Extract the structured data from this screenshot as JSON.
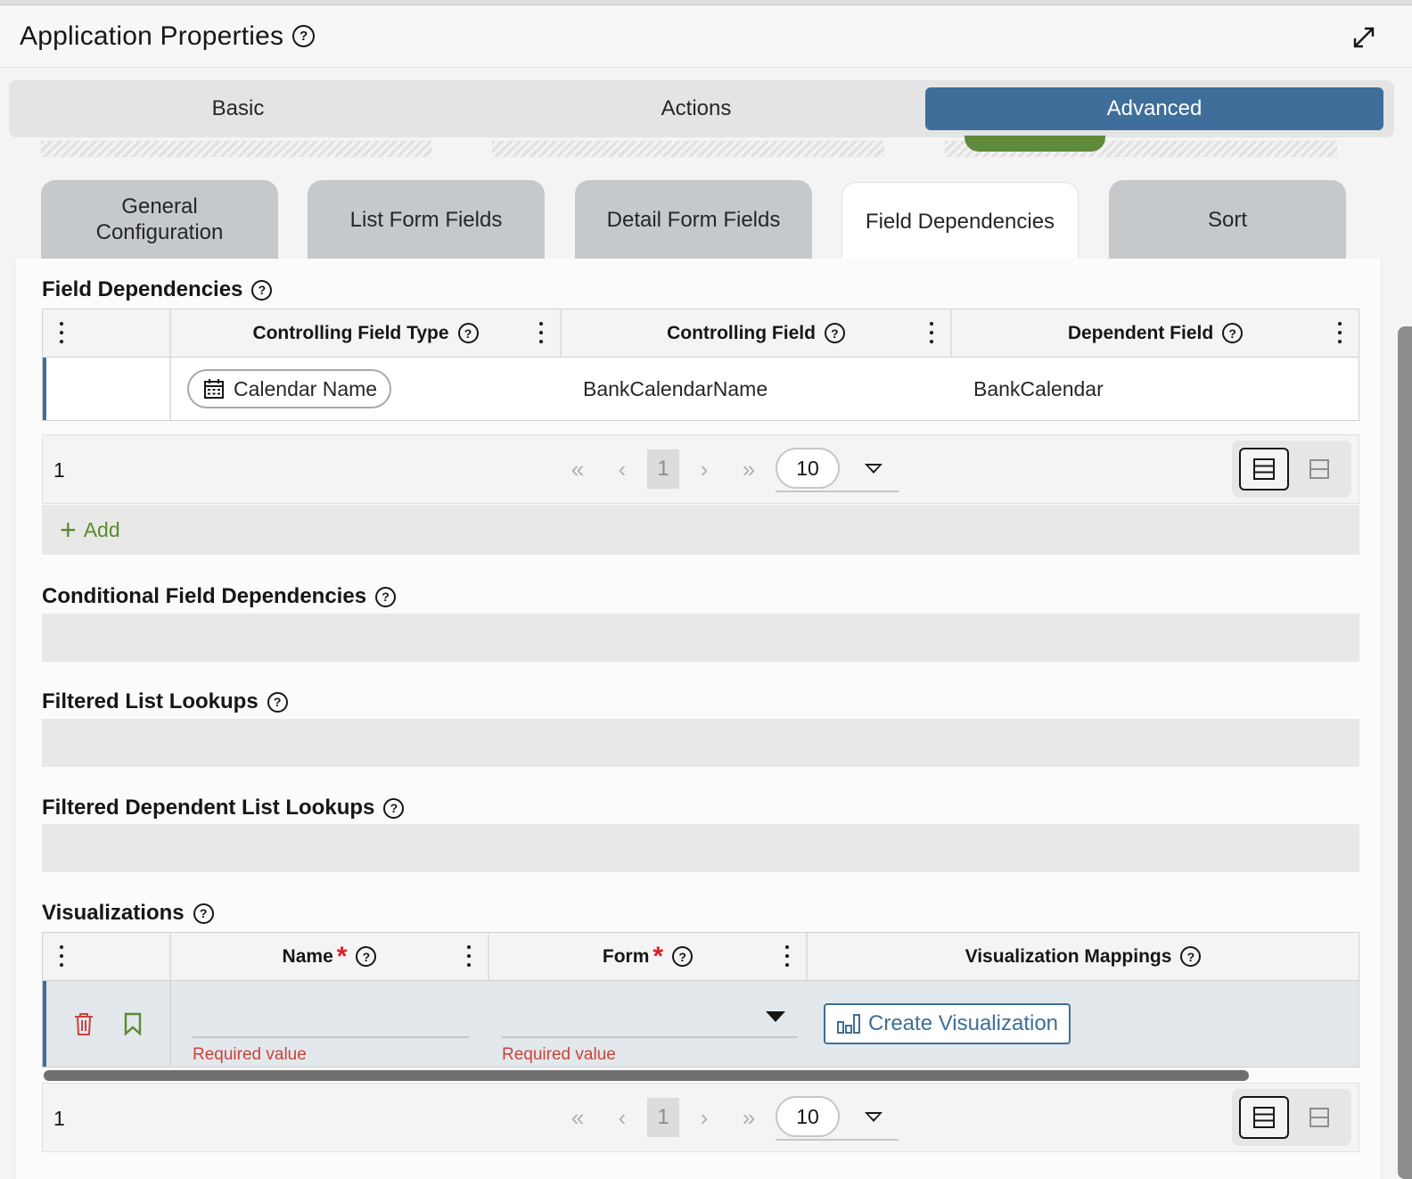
{
  "window": {
    "title": "Application Properties"
  },
  "main_tabs": [
    {
      "label": "Basic",
      "active": false
    },
    {
      "label": "Actions",
      "active": false
    },
    {
      "label": "Advanced",
      "active": true
    }
  ],
  "sub_tabs": [
    {
      "label": "General Configuration",
      "active": false
    },
    {
      "label": "List Form Fields",
      "active": false
    },
    {
      "label": "Detail Form Fields",
      "active": false
    },
    {
      "label": "Field Dependencies",
      "active": true
    },
    {
      "label": "Sort",
      "active": false
    }
  ],
  "field_dependencies": {
    "title": "Field Dependencies",
    "columns": [
      "Controlling Field Type",
      "Controlling Field",
      "Dependent Field"
    ],
    "rows": [
      {
        "controlling_field_type": "Calendar Name",
        "controlling_field": "BankCalendarName",
        "dependent_field": "BankCalendar"
      }
    ],
    "pager": {
      "count": "1",
      "page": "1",
      "page_size": "10"
    },
    "add_label": "Add"
  },
  "sections": {
    "conditional": "Conditional Field Dependencies",
    "filtered_list": "Filtered List Lookups",
    "filtered_dependent": "Filtered Dependent List Lookups"
  },
  "visualizations": {
    "title": "Visualizations",
    "columns": [
      "Name",
      "Form",
      "Visualization Mappings"
    ],
    "required_marker": "*",
    "row": {
      "name_error": "Required value",
      "form_error": "Required value",
      "create_button": "Create Visualization"
    },
    "pager": {
      "count": "1",
      "page": "1",
      "page_size": "10"
    }
  },
  "icons": {
    "help": "help-icon",
    "expand": "expand-icon",
    "calendar": "calendar-icon",
    "trash": "trash-icon",
    "bookmark": "bookmark-icon",
    "chart": "chart-bar-icon"
  },
  "colors": {
    "accent": "#3e6e99",
    "add_green": "#5b8a2f",
    "error": "#da1e28"
  }
}
